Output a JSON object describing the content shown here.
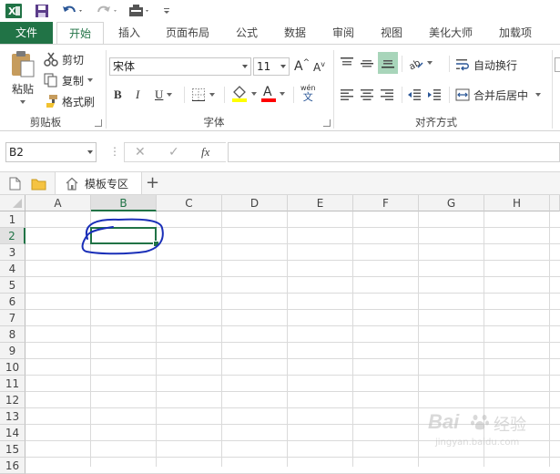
{
  "window": {
    "app_icon": "excel-logo-icon",
    "quick_access": [
      "save-icon",
      "undo-icon",
      "redo-icon",
      "form-icon",
      "customize-qat-icon"
    ]
  },
  "tabs": {
    "file": "文件",
    "items": [
      "开始",
      "插入",
      "页面布局",
      "公式",
      "数据",
      "审阅",
      "视图",
      "美化大师",
      "加载项"
    ],
    "active": "开始"
  },
  "ribbon": {
    "clipboard": {
      "paste": "粘贴",
      "cut": "剪切",
      "copy": "复制",
      "format_painter": "格式刷",
      "label": "剪贴板"
    },
    "font": {
      "name": "宋体",
      "size": "11",
      "grow": "A",
      "shrink": "A",
      "bold": "B",
      "italic": "I",
      "underline": "U",
      "font_color_letter": "A",
      "phonetic_top": "wén",
      "phonetic_bottom": "文",
      "label": "字体",
      "fill_color": "#ffff00",
      "font_color": "#ff0000"
    },
    "alignment": {
      "wrap_text": "自动换行",
      "merge_center": "合并后居中",
      "label": "对齐方式",
      "selected_fill": "#a8d5ba"
    }
  },
  "formula_bar": {
    "name_box": "B2",
    "cancel": "✕",
    "enter": "✓",
    "fx": "fx",
    "value": ""
  },
  "sheet_tabs": {
    "template_area": "模板专区",
    "add": "+"
  },
  "grid": {
    "columns": [
      "A",
      "B",
      "C",
      "D",
      "E",
      "F",
      "G",
      "H"
    ],
    "rows": [
      "1",
      "2",
      "3",
      "4",
      "5",
      "6",
      "7",
      "8",
      "9",
      "10",
      "11",
      "12",
      "13",
      "14",
      "15",
      "16"
    ],
    "selected_cell": "B2",
    "accent": "#217346",
    "annotation_color": "#1a2fb8"
  },
  "watermark": {
    "brand": "Bai",
    "brand2": "经验",
    "url": "jingyan.baidu.com"
  }
}
